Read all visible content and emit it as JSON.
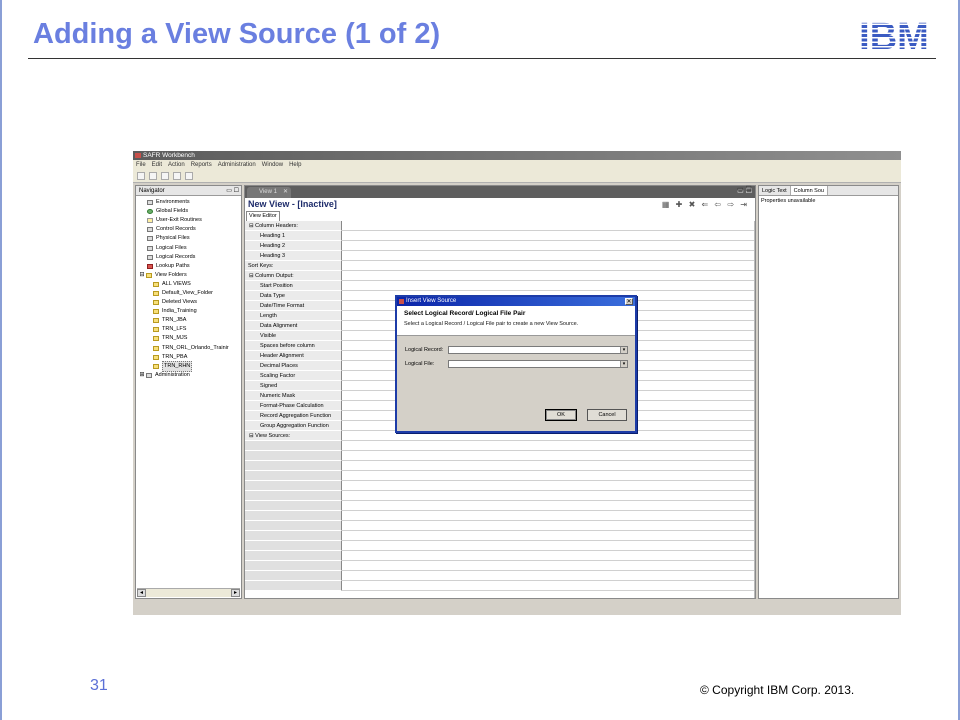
{
  "slide": {
    "title": "Adding a View Source (1 of 2)",
    "logo": "IBM",
    "page_number": "31",
    "copyright": "© Copyright IBM Corp. 2013."
  },
  "app": {
    "window_title": "SAFR Workbench",
    "menu": [
      "File",
      "Edit",
      "Action",
      "Reports",
      "Administration",
      "Window",
      "Help"
    ]
  },
  "navigator": {
    "tab_label": "Navigator",
    "items": [
      {
        "label": "Environments",
        "icon": "environments-icon",
        "level": 1
      },
      {
        "label": "Global Fields",
        "icon": "globe-icon",
        "level": 1
      },
      {
        "label": "User-Exit Routines",
        "icon": "routine-icon",
        "level": 1
      },
      {
        "label": "Control Records",
        "icon": "record-icon",
        "level": 1
      },
      {
        "label": "Physical Files",
        "icon": "file-icon",
        "level": 1
      },
      {
        "label": "Logical Files",
        "icon": "file-icon",
        "level": 1
      },
      {
        "label": "Logical Records",
        "icon": "record-icon",
        "level": 1
      },
      {
        "label": "Lookup Paths",
        "icon": "lookup-icon",
        "level": 1
      },
      {
        "label": "View Folders",
        "icon": "folder-icon",
        "level": 0,
        "expander": "⊟"
      },
      {
        "label": "ALL VIEWS",
        "icon": "folder-icon",
        "level": 2
      },
      {
        "label": "Default_View_Folder",
        "icon": "folder-icon",
        "level": 2
      },
      {
        "label": "Deleted Views",
        "icon": "folder-icon",
        "level": 2
      },
      {
        "label": "India_Training",
        "icon": "folder-icon",
        "level": 2
      },
      {
        "label": "TRN_JBA",
        "icon": "folder-icon",
        "level": 2
      },
      {
        "label": "TRN_LFS",
        "icon": "folder-icon",
        "level": 2
      },
      {
        "label": "TRN_MJS",
        "icon": "folder-icon",
        "level": 2
      },
      {
        "label": "TRN_ORL_Orlando_Trainir",
        "icon": "folder-icon",
        "level": 2
      },
      {
        "label": "TRN_PBA",
        "icon": "folder-icon",
        "level": 2
      },
      {
        "label": "TRN_RHN",
        "icon": "folder-icon",
        "level": 2,
        "selected": true
      },
      {
        "label": "Administration",
        "icon": "admin-icon",
        "level": 0,
        "expander": "⊞"
      }
    ]
  },
  "editor": {
    "tab_label": "View 1",
    "title": "New View - [Inactive]",
    "subtab": "View Editor",
    "rows": [
      {
        "label": "⊟  Column Headers:",
        "kind": "group"
      },
      {
        "label": "Heading 1",
        "kind": "l2"
      },
      {
        "label": "Heading 2",
        "kind": "l2"
      },
      {
        "label": "Heading 3",
        "kind": "l2"
      },
      {
        "label": "Sort Keys:",
        "kind": "plain"
      },
      {
        "label": "⊟  Column Output:",
        "kind": "group"
      },
      {
        "label": "Start Position",
        "kind": "l2"
      },
      {
        "label": "Data Type",
        "kind": "l2"
      },
      {
        "label": "Date/Time Format",
        "kind": "l2"
      },
      {
        "label": "Length",
        "kind": "l2"
      },
      {
        "label": "Data Alignment",
        "kind": "l2"
      },
      {
        "label": "Visible",
        "kind": "l2"
      },
      {
        "label": "Spaces before column",
        "kind": "l2"
      },
      {
        "label": "Header Alignment",
        "kind": "l2"
      },
      {
        "label": "Decimal Places",
        "kind": "l2"
      },
      {
        "label": "Scaling Factor",
        "kind": "l2"
      },
      {
        "label": "Signed",
        "kind": "l2"
      },
      {
        "label": "Numeric Mask",
        "kind": "l2"
      },
      {
        "label": "Format-Phase Calculation",
        "kind": "l2"
      },
      {
        "label": "Record Aggregation Function",
        "kind": "l2"
      },
      {
        "label": "Group Aggregation Function",
        "kind": "l2"
      },
      {
        "label": "⊟  View Sources:",
        "kind": "group"
      }
    ],
    "blank_rows": 15
  },
  "properties": {
    "tabs": [
      "Logic Text",
      "Column Sou"
    ],
    "body": "Properties unavailable"
  },
  "dialog": {
    "title": "Insert View Source",
    "heading": "Select Logical Record/ Logical File Pair",
    "subtext": "Select a Logical Record / Logical File pair to create a new View Source.",
    "logical_record_label": "Logical Record:",
    "logical_file_label": "Logical File:",
    "logical_record_value": "",
    "logical_file_value": "",
    "ok_label": "OK",
    "cancel_label": "Cancel"
  }
}
